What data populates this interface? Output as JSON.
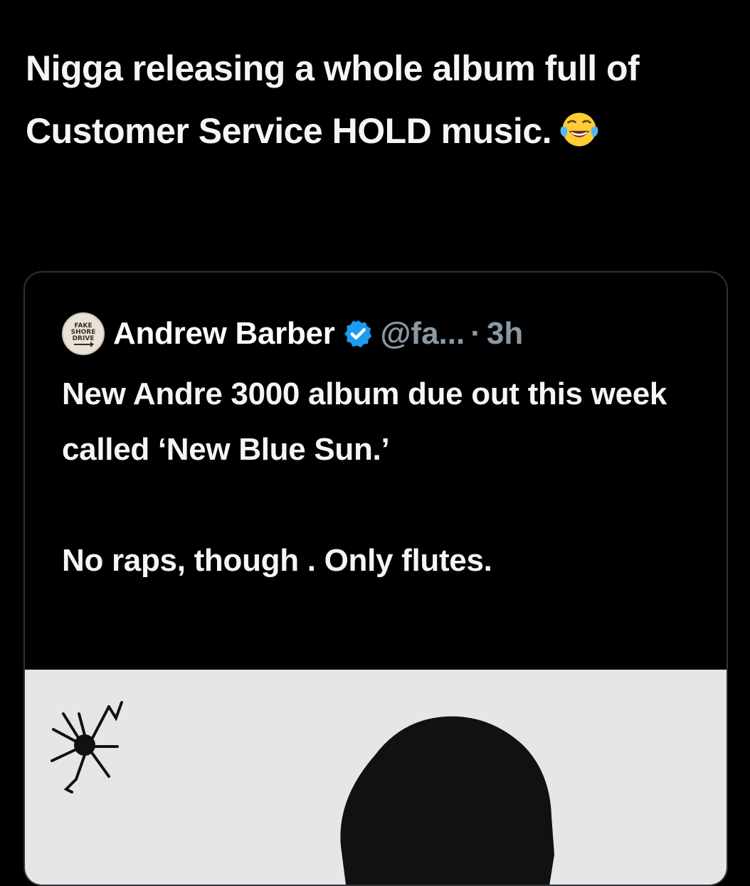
{
  "post": {
    "text": "Nigga releasing a whole album full of Customer Service HOLD music.",
    "emoji": "face-with-tears-of-joy-icon"
  },
  "quoted_post": {
    "author_name": "Andrew Barber",
    "handle": "@fa...",
    "separator": "·",
    "time": "3h",
    "verified": true,
    "avatar_text": [
      "FAKE",
      "SHORE",
      "DRIVE"
    ],
    "text": "New Andre 3000 album due out this week called ‘New Blue Sun.’\n\nNo raps, though . Only flutes.",
    "media": "album-cover-image"
  },
  "colors": {
    "background": "#000000",
    "text": "#f5f5f5",
    "muted": "#8b98a5",
    "border": "#2f3336",
    "verified_blue": "#1d9bf0",
    "media_background": "#e6e6e6"
  }
}
